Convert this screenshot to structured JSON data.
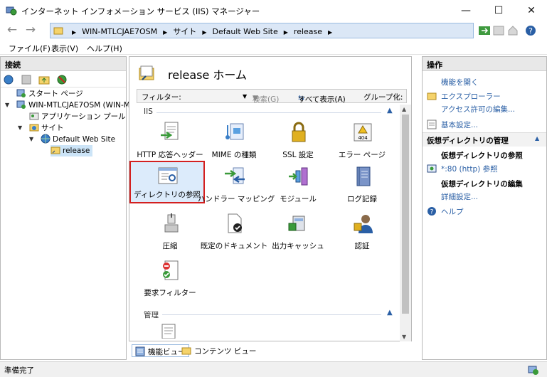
{
  "window": {
    "title": "インターネット インフォメーション サービス (IIS) マネージャー",
    "minimize": "—",
    "maximize": "☐",
    "close": "✕"
  },
  "address": {
    "crumbs": [
      "WIN-MTLCJAE7OSM",
      "サイト",
      "Default Web Site",
      "release"
    ],
    "separator": "▶"
  },
  "menu": {
    "file": "ファイル(F)",
    "view": "表示(V)",
    "help": "ヘルプ(H)"
  },
  "left_panel": {
    "header": "接続",
    "tree": {
      "start_page": "スタート ページ",
      "server": "WIN-MTLCJAE7OSM (WIN-MT",
      "app_pools": "アプリケーション プール",
      "sites": "サイト",
      "default_site": "Default Web Site",
      "release": "release"
    }
  },
  "center": {
    "title": "release ホーム",
    "filter": {
      "label": "フィルター:",
      "search": "検索(G)",
      "show_all": "すべて表示(A)",
      "group": "グループ化:"
    },
    "groups": {
      "iis": "IIS",
      "management": "管理"
    },
    "features": [
      {
        "label": "HTTP 応答ヘッダー"
      },
      {
        "label": "MIME の種類"
      },
      {
        "label": "SSL 設定"
      },
      {
        "label": "エラー ページ"
      },
      {
        "label": "ディレクトリの参照"
      },
      {
        "label": "ハンドラー マッピング"
      },
      {
        "label": "モジュール"
      },
      {
        "label": "ログ記録"
      },
      {
        "label": "圧縮"
      },
      {
        "label": "既定のドキュメント"
      },
      {
        "label": "出力キャッシュ"
      },
      {
        "label": "認証"
      },
      {
        "label": "要求フィルター"
      }
    ]
  },
  "bottom_tabs": {
    "features_view": "機能ビュー",
    "content_view": "コンテンツ ビュー"
  },
  "actions": {
    "header": "操作",
    "open_feature": "機能を開く",
    "explore": "エクスプローラー",
    "edit_permissions": "アクセス許可の編集...",
    "basic_settings": "基本設定...",
    "vdir_manage": "仮想ディレクトリの管理",
    "browse_vdir": "仮想ディレクトリの参照",
    "browse_80": "*:80 (http) 参照",
    "edit_vdir": "仮想ディレクトリの編集",
    "advanced": "詳細設定...",
    "help": "ヘルプ"
  },
  "status": {
    "text": "準備完了"
  },
  "colors": {
    "link": "#2a5fa5",
    "selection_outline": "#d32020",
    "panel_header": "#e8e8e8"
  }
}
